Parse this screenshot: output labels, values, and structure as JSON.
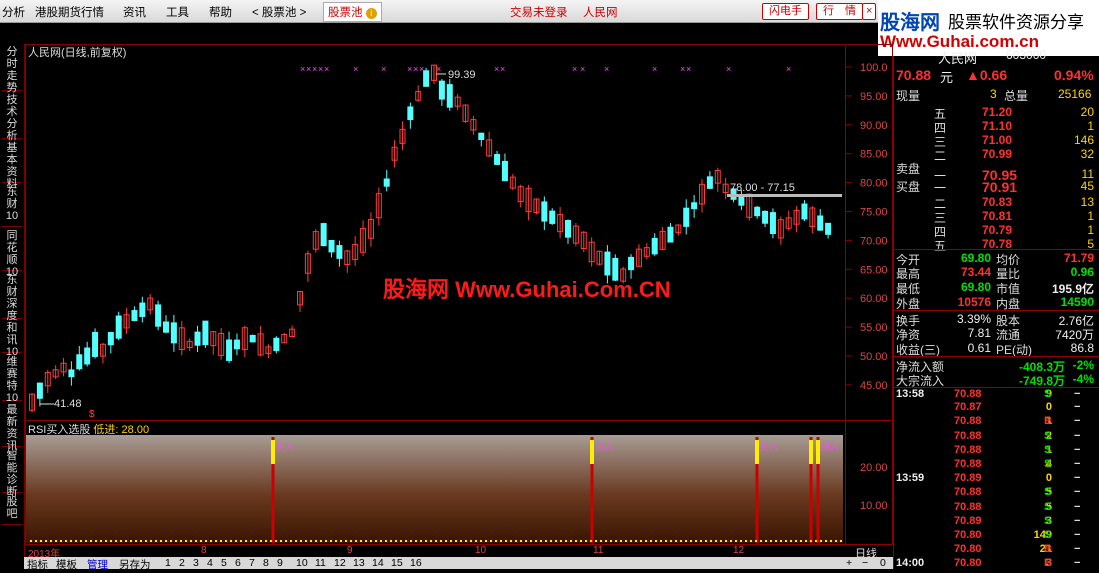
{
  "menu": {
    "items": [
      "分析",
      "港股期货行情",
      "资讯",
      "工具",
      "帮助",
      "< 股票池 >"
    ],
    "active_tab": "股票池",
    "login": "交易未登录",
    "site": "人民网",
    "btn_flash": "闪电手",
    "btn_quote": "行　情",
    "btn_close": "×"
  },
  "logo": {
    "name": "股海网",
    "slogan": "股票软件资源分享",
    "url": "Www.Guhai.com.cn"
  },
  "left_tabs": [
    "分时走势",
    "技术分析",
    "基本资料",
    "东财10",
    "同花顺10",
    "东财深度",
    "和讯10",
    "维赛特10",
    "最新资讯",
    "智能诊断",
    "股吧"
  ],
  "chart": {
    "title": "人民网(日线,前复权)",
    "watermark": "股海网 Www.Guhai.Com.CN",
    "max_label": "99.39",
    "min_label": "41.48",
    "range_label": "78.00 - 77.15",
    "indicator_name": "RSI买入选股",
    "indicator_param_label": "低进:",
    "indicator_param_value": "28.00",
    "signal_text": "买入",
    "price_axis": [
      "100.0",
      "95.00",
      "90.00",
      "85.00",
      "80.00",
      "75.00",
      "70.00",
      "65.00",
      "60.00",
      "55.00",
      "50.00",
      "45.00"
    ],
    "ind_axis": [
      "20.00",
      "10.00"
    ],
    "time_labels": [
      "2013年",
      "8",
      "9",
      "10",
      "11",
      "12"
    ],
    "period": "日线"
  },
  "bottom_bar": {
    "items": [
      "指标",
      "模板",
      "管理",
      "另存为",
      "1",
      "2",
      "3",
      "4",
      "5",
      "6",
      "7",
      "8",
      "9",
      "10",
      "11",
      "12",
      "13",
      "14",
      "15",
      "16"
    ],
    "active": "管理",
    "controls": [
      "+",
      "−",
      "0"
    ]
  },
  "quote": {
    "name": "人民网",
    "code": "603000",
    "price": "70.88",
    "unit": "元",
    "change": "▲0.66",
    "change_pct": "0.94%",
    "volume_label": "现量",
    "volume": "3",
    "total_label": "总量",
    "total": "25166",
    "sell": [
      {
        "label": "五",
        "price": "71.20",
        "vol": "20"
      },
      {
        "label": "四",
        "price": "71.10",
        "vol": "1"
      },
      {
        "label": "三",
        "price": "71.00",
        "vol": "146"
      },
      {
        "label": "二",
        "price": "70.99",
        "vol": "32"
      },
      {
        "label": "一",
        "price": "70.95",
        "vol": "11"
      }
    ],
    "sell_title": "卖盘",
    "buy_title": "买盘",
    "buy": [
      {
        "label": "一",
        "price": "70.91",
        "vol": "45"
      },
      {
        "label": "二",
        "price": "70.83",
        "vol": "13"
      },
      {
        "label": "三",
        "price": "70.81",
        "vol": "1"
      },
      {
        "label": "四",
        "price": "70.79",
        "vol": "1"
      },
      {
        "label": "五",
        "price": "70.78",
        "vol": "5"
      }
    ],
    "stats": [
      {
        "l1": "今开",
        "v1": "69.80",
        "c1": "g",
        "l2": "均价",
        "v2": "71.79",
        "c2": "r"
      },
      {
        "l1": "最高",
        "v1": "73.44",
        "c1": "r",
        "l2": "量比",
        "v2": "0.96",
        "c2": "g"
      },
      {
        "l1": "最低",
        "v1": "69.80",
        "c1": "g",
        "l2": "市值",
        "v2": "195.9亿",
        "c2": "w"
      },
      {
        "l1": "外盘",
        "v1": "10576",
        "c1": "r",
        "l2": "内盘",
        "v2": "14590",
        "c2": "g"
      }
    ],
    "stats2": [
      {
        "l1": "换手",
        "v1": "3.39%",
        "l2": "股本",
        "v2": "2.76亿"
      },
      {
        "l1": "净资",
        "v1": "7.81",
        "l2": "流通",
        "v2": "7420万"
      },
      {
        "l1": "收益(三)",
        "v1": "0.61",
        "l2": "PE(动)",
        "v2": "86.8"
      }
    ],
    "flow": [
      {
        "label": "净流入额",
        "value": "-408.3万",
        "pct": "-2%"
      },
      {
        "label": "大宗流入",
        "value": "-749.8万",
        "pct": "-4%"
      }
    ],
    "ticks": [
      {
        "time": "13:58",
        "price": "70.88",
        "vol": "9",
        "bs": "S"
      },
      {
        "time": "",
        "price": "70.87",
        "vol": "0",
        "bs": ""
      },
      {
        "time": "",
        "price": "70.88",
        "vol": "1",
        "bs": "B"
      },
      {
        "time": "",
        "price": "70.88",
        "vol": "2",
        "bs": "S"
      },
      {
        "time": "",
        "price": "70.88",
        "vol": "1",
        "bs": "S"
      },
      {
        "time": "",
        "price": "70.88",
        "vol": "4",
        "bs": "S"
      },
      {
        "time": "13:59",
        "price": "70.89",
        "vol": "0",
        "bs": ""
      },
      {
        "time": "",
        "price": "70.88",
        "vol": "5",
        "bs": "S"
      },
      {
        "time": "",
        "price": "70.88",
        "vol": "5",
        "bs": "S"
      },
      {
        "time": "",
        "price": "70.89",
        "vol": "3",
        "bs": "S"
      },
      {
        "time": "",
        "price": "70.80",
        "vol": "149",
        "bs": "S"
      },
      {
        "time": "",
        "price": "70.80",
        "vol": "21",
        "bs": "B"
      },
      {
        "time": "14:00",
        "price": "70.80",
        "vol": "3",
        "bs": "B"
      }
    ],
    "tick_dash": "−"
  }
}
